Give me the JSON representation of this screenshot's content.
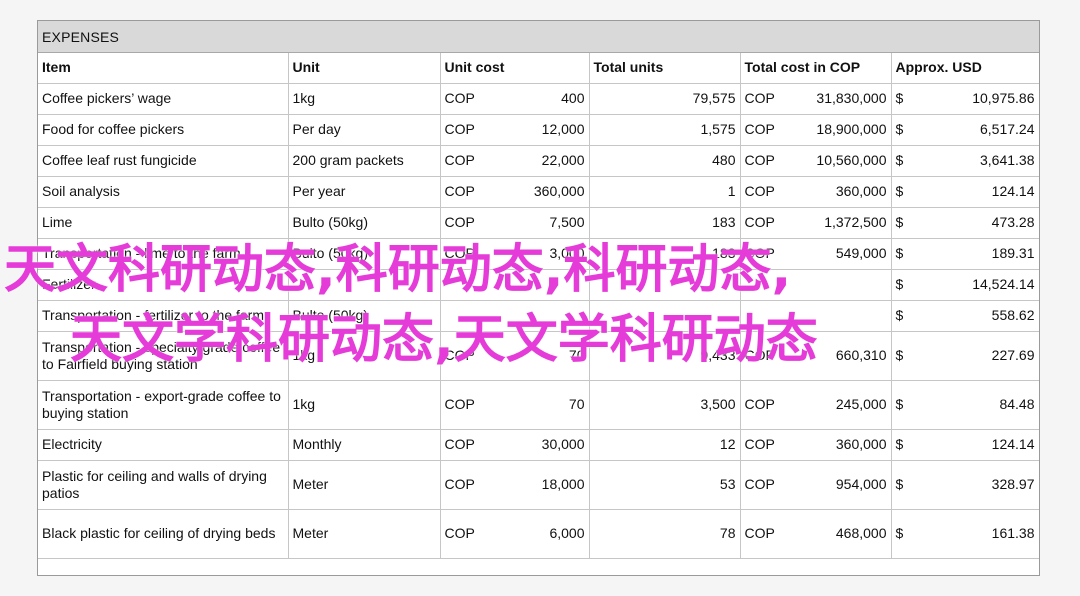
{
  "title": "EXPENSES",
  "headers": {
    "item": "Item",
    "unit": "Unit",
    "unit_cost": "Unit cost",
    "total_units": "Total units",
    "total_cost": "Total cost in COP",
    "approx_usd": "Approx. USD"
  },
  "currency": {
    "cop": "COP",
    "usd": "$"
  },
  "rows": [
    {
      "item": "Coffee pickers’ wage",
      "unit": "1kg",
      "unit_cost": "400",
      "total_units": "79,575",
      "total_cost": "31,830,000",
      "usd": "10,975.86"
    },
    {
      "item": "Food for coffee pickers",
      "unit": "Per day",
      "unit_cost": "12,000",
      "total_units": "1,575",
      "total_cost": "18,900,000",
      "usd": "6,517.24"
    },
    {
      "item": "Coffee leaf rust fungicide",
      "unit": "200 gram packets",
      "unit_cost": "22,000",
      "total_units": "480",
      "total_cost": "10,560,000",
      "usd": "3,641.38"
    },
    {
      "item": "Soil analysis",
      "unit": "Per year",
      "unit_cost": "360,000",
      "total_units": "1",
      "total_cost": "360,000",
      "usd": "124.14"
    },
    {
      "item": "Lime",
      "unit": "Bulto (50kg)",
      "unit_cost": "7,500",
      "total_units": "183",
      "total_cost": "1,372,500",
      "usd": "473.28"
    },
    {
      "item": "Transportation - lime to the farm",
      "unit": "Bulto (50kg)",
      "unit_cost": "3,000",
      "total_units": "183",
      "total_cost": "549,000",
      "usd": "189.31"
    },
    {
      "item": "Fertilizer",
      "unit": "",
      "unit_cost": "",
      "total_units": "",
      "total_cost": "",
      "usd": "14,524.14"
    },
    {
      "item": "Transportation - fertilizer to the farm",
      "unit": "Bulto (50kg)",
      "unit_cost": "",
      "total_units": "",
      "total_cost": "",
      "usd": "558.62"
    },
    {
      "item": "Transportation - specialty grade coffee to Fairfield buying station",
      "unit": "1kg",
      "unit_cost": "70",
      "total_units": "9,433",
      "total_cost": "660,310",
      "usd": "227.69"
    },
    {
      "item": "Transportation - export-grade coffee to buying station",
      "unit": "1kg",
      "unit_cost": "70",
      "total_units": "3,500",
      "total_cost": "245,000",
      "usd": "84.48"
    },
    {
      "item": "Electricity",
      "unit": "Monthly",
      "unit_cost": "30,000",
      "total_units": "12",
      "total_cost": "360,000",
      "usd": "124.14"
    },
    {
      "item": "Plastic for ceiling and walls of drying patios",
      "unit": "Meter",
      "unit_cost": "18,000",
      "total_units": "53",
      "total_cost": "954,000",
      "usd": "328.97"
    },
    {
      "item": "Black plastic for ceiling of drying beds",
      "unit": "Meter",
      "unit_cost": "6,000",
      "total_units": "78",
      "total_cost": "468,000",
      "usd": "161.38"
    }
  ],
  "watermark": {
    "line1": "天文科研动态,科研动态,科研动态,",
    "line2": "天文学科研动态,天文学科研动态"
  }
}
